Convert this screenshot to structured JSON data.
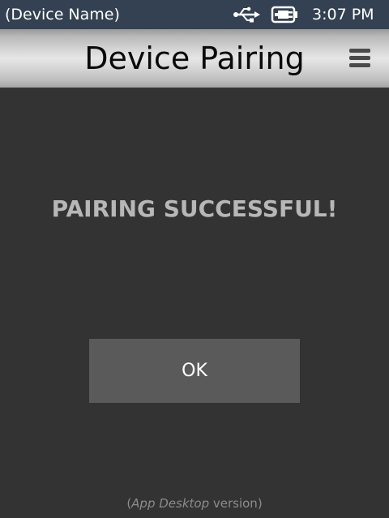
{
  "status_bar": {
    "device_name": "(Device Name)",
    "usb_icon": "usb-icon",
    "battery_icon": "battery-charging-icon",
    "time": "3:07 PM"
  },
  "title_bar": {
    "title": "Device Pairing",
    "menu_icon": "hamburger-menu-icon"
  },
  "main": {
    "message": "PAIRING SUCCESSFUL!",
    "ok_label": "OK"
  },
  "footer": {
    "open_paren": "(",
    "app_name": "App Desktop",
    "suffix": " version)"
  },
  "colors": {
    "status_bar_bg": "#334152",
    "background": "#333333",
    "message_text": "#b7b7b7",
    "ok_button_bg": "#5a5a5a",
    "footer_text": "#8c8c8c"
  }
}
